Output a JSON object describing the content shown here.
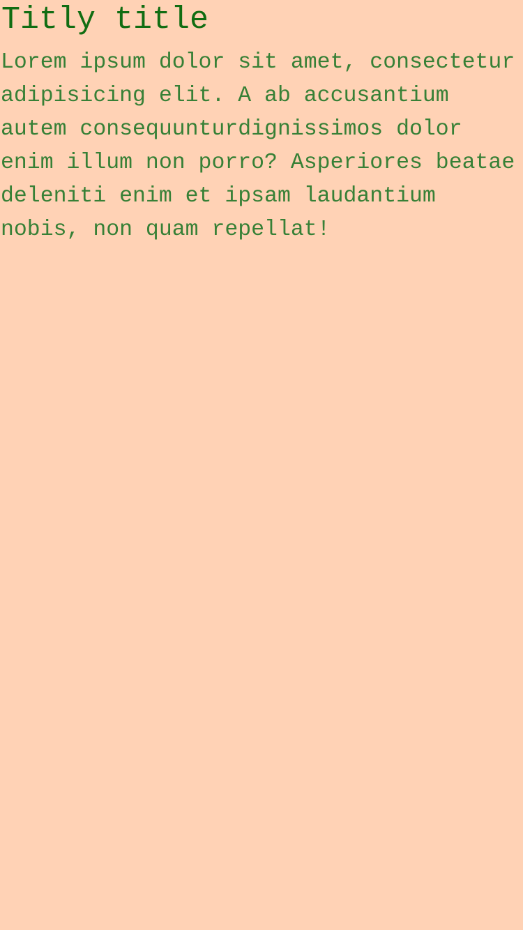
{
  "page": {
    "background": "#ffd2b5",
    "title": "Titly title",
    "title_color": "#116d12",
    "body": "Lorem ipsum dolor sit amet, consectetur\nadipisicing elit. A ab accusantium\nautem consequunturdignissimos dolor\nenim illum non porro? Asperiores beatae\ndeleniti enim et ipsam laudantium\nnobis, non quam repellat!",
    "body_color": "#378036"
  }
}
